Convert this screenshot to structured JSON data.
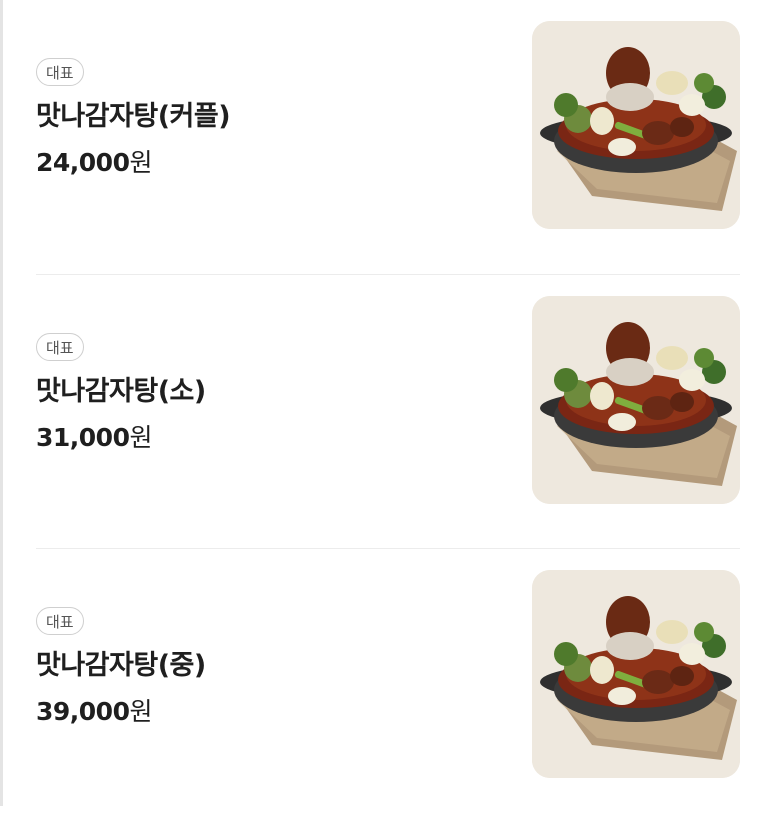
{
  "menu": {
    "items": [
      {
        "badge": "대표",
        "name": "맛나감자탕(커플)",
        "price": "24,000",
        "currency": "원",
        "image_icon": "gamjatang-photo"
      },
      {
        "badge": "대표",
        "name": "맛나감자탕(소)",
        "price": "31,000",
        "currency": "원",
        "image_icon": "gamjatang-photo"
      },
      {
        "badge": "대표",
        "name": "맛나감자탕(중)",
        "price": "39,000",
        "currency": "원",
        "image_icon": "gamjatang-photo"
      }
    ]
  },
  "colors": {
    "text": "#1f1f1f",
    "badge_border": "#cfcfcf",
    "divider": "#ececec",
    "photo_bg": "#eee8de"
  }
}
